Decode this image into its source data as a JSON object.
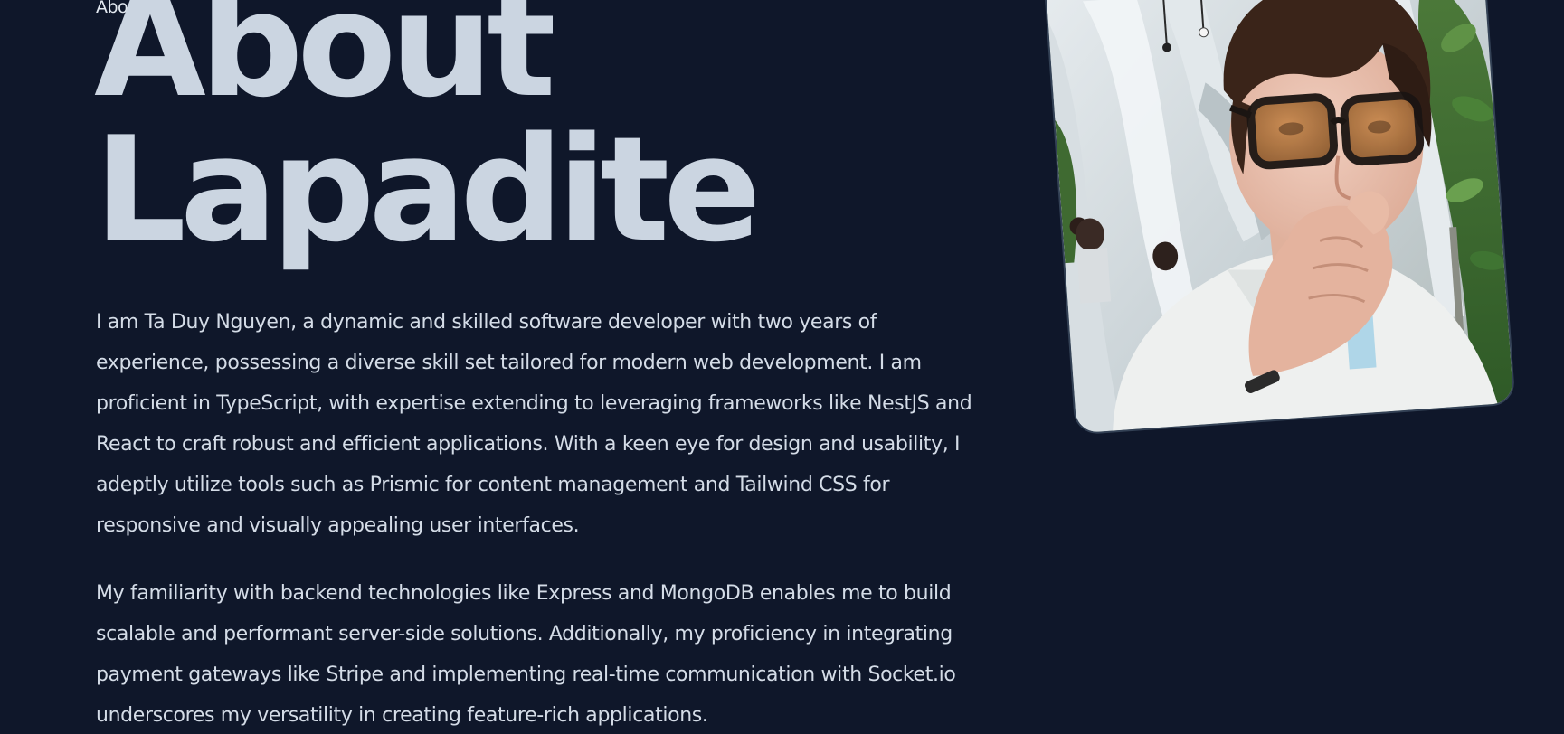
{
  "nav": {
    "about_label": "About"
  },
  "hero": {
    "title_line1": "About",
    "title_line2": "Lapadite"
  },
  "bio": {
    "paragraph1": "I am Ta Duy Nguyen, a dynamic and skilled software developer with two years of experience, possessing a diverse skill set tailored for modern web development. I am proficient in TypeScript, with expertise extending to leveraging frameworks like NestJS and React to craft robust and efficient applications. With a keen eye for design and usability, I adeptly utilize tools such as Prismic for content management and Tailwind CSS for responsive and visually appealing user interfaces.",
    "paragraph2": "My familiarity with backend technologies like Express and MongoDB enables me to build scalable and performant server-side solutions. Additionally, my proficiency in integrating payment gateways like Stripe and implementing real-time communication with Socket.io underscores my versatility in creating feature-rich applications."
  },
  "colors": {
    "background": "#0f172a",
    "title": "#cbd5e1",
    "body_text": "#d4dce7"
  },
  "profile_photo": {
    "icon": "profile-photo"
  }
}
